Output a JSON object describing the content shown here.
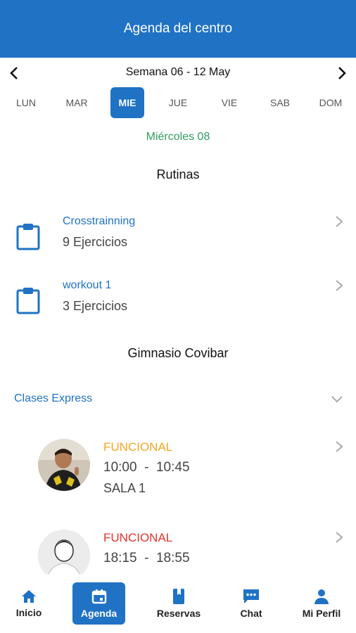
{
  "header": {
    "title": "Agenda del centro"
  },
  "week": {
    "label": "Semana 06 - 12 May"
  },
  "days": [
    {
      "label": "LUN"
    },
    {
      "label": "MAR"
    },
    {
      "label": "MIE"
    },
    {
      "label": "JUE"
    },
    {
      "label": "VIE"
    },
    {
      "label": "SAB"
    },
    {
      "label": "DOM"
    }
  ],
  "selected_day_index": 2,
  "selected_date": "Miércoles 08",
  "routines": {
    "title": "Rutinas",
    "items": [
      {
        "name": "Crosstrainning",
        "detail": "9 Ejercicios"
      },
      {
        "name": "workout 1",
        "detail": "3 Ejercicios"
      }
    ]
  },
  "gym": {
    "title": "Gimnasio Covibar",
    "group": {
      "label": "Clases Express"
    },
    "classes": [
      {
        "name": "FUNCIONAL",
        "name_color": "#f5a623",
        "time": "10:00  -  10:45",
        "room": "SALA 1"
      },
      {
        "name": "FUNCIONAL",
        "name_color": "#e0342c",
        "time": "18:15  -  18:55",
        "room": ""
      }
    ]
  },
  "bottom_nav": [
    {
      "label": "Inicio",
      "icon": "home-icon"
    },
    {
      "label": "Agenda",
      "icon": "calendar-icon"
    },
    {
      "label": "Reservas",
      "icon": "book-icon"
    },
    {
      "label": "Chat",
      "icon": "chat-icon"
    },
    {
      "label": "Mi Perfil",
      "icon": "person-icon"
    }
  ],
  "colors": {
    "primary": "#1f72c4",
    "date_green": "#2e9d5f",
    "orange": "#f5a623",
    "red": "#e0342c"
  }
}
